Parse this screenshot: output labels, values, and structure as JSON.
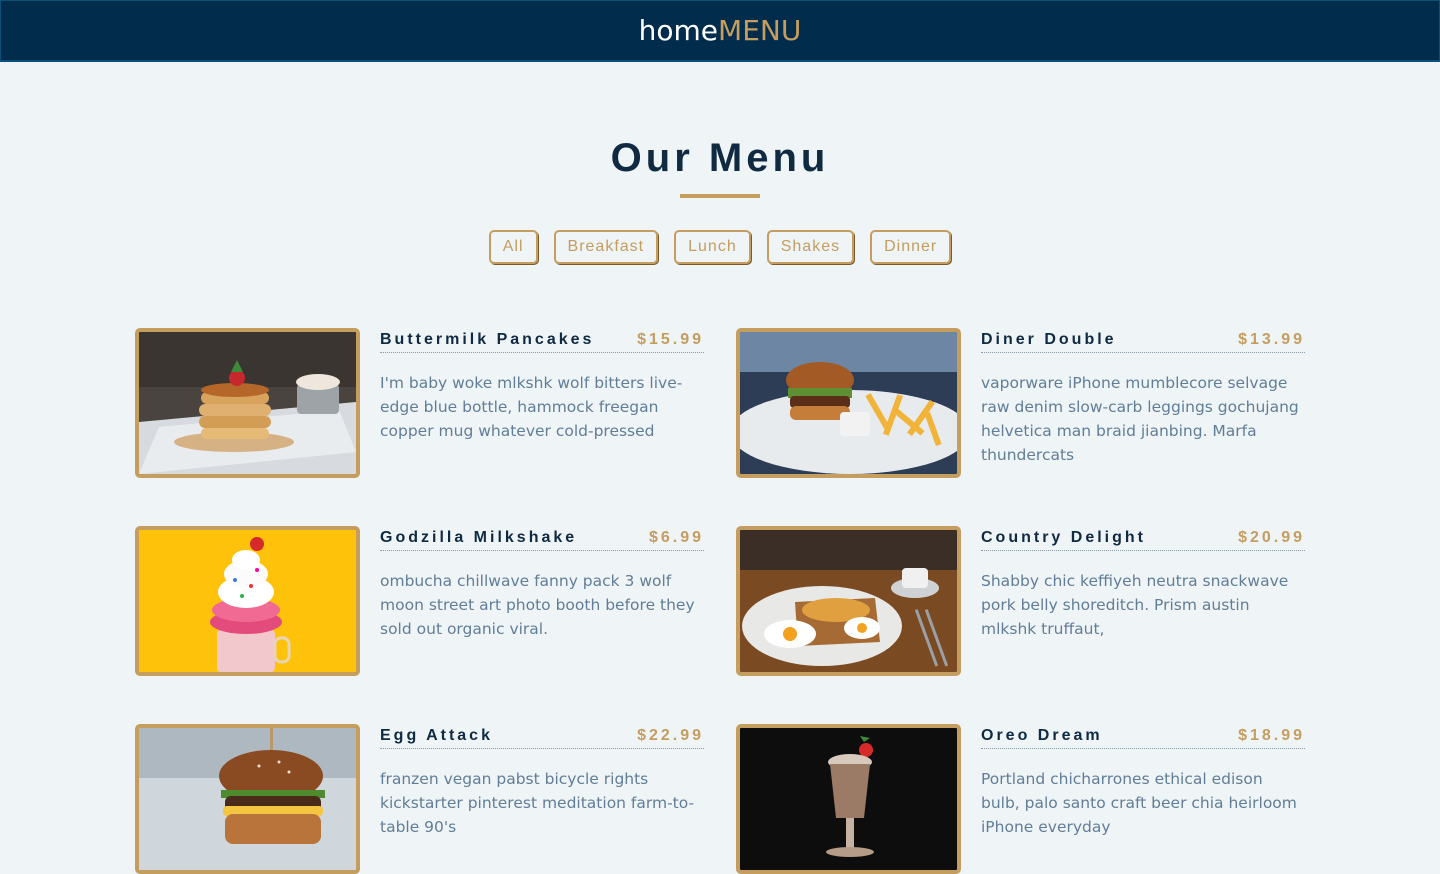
{
  "navbar": {
    "brand_home": "home",
    "brand_menu": "MENU"
  },
  "section": {
    "title": "Our Menu"
  },
  "filters": [
    "All",
    "Breakfast",
    "Lunch",
    "Shakes",
    "Dinner"
  ],
  "colors": {
    "accent": "#c59d5f",
    "navy": "#102a42",
    "nav_bg": "#022c4b",
    "text": "#617d98",
    "bg": "#eff4f6"
  },
  "items": [
    {
      "name": "Buttermilk Pancakes",
      "price": "$15.99",
      "desc": "I'm baby woke mlkshk wolf bitters live-edge blue bottle, hammock freegan copper mug whatever cold-pressed",
      "image": "pancakes-photo"
    },
    {
      "name": "Diner Double",
      "price": "$13.99",
      "desc": "vaporware iPhone mumblecore selvage raw denim slow-carb leggings gochujang helvetica man braid jianbing. Marfa thundercats",
      "image": "burger-fries-photo"
    },
    {
      "name": "Godzilla Milkshake",
      "price": "$6.99",
      "desc": "ombucha chillwave fanny pack 3 wolf moon street art photo booth before they sold out organic viral.",
      "image": "milkshake-photo"
    },
    {
      "name": "Country Delight",
      "price": "$20.99",
      "desc": "Shabby chic keffiyeh neutra snackwave pork belly shoreditch. Prism austin mlkshk truffaut,",
      "image": "eggs-toast-photo"
    },
    {
      "name": "Egg Attack",
      "price": "$22.99",
      "desc": "franzen vegan pabst bicycle rights kickstarter pinterest meditation farm-to-table 90's",
      "image": "egg-burger-photo"
    },
    {
      "name": "Oreo Dream",
      "price": "$18.99",
      "desc": "Portland chicharrones ethical edison bulb, palo santo craft beer chia heirloom iPhone everyday",
      "image": "oreo-shake-photo"
    }
  ]
}
